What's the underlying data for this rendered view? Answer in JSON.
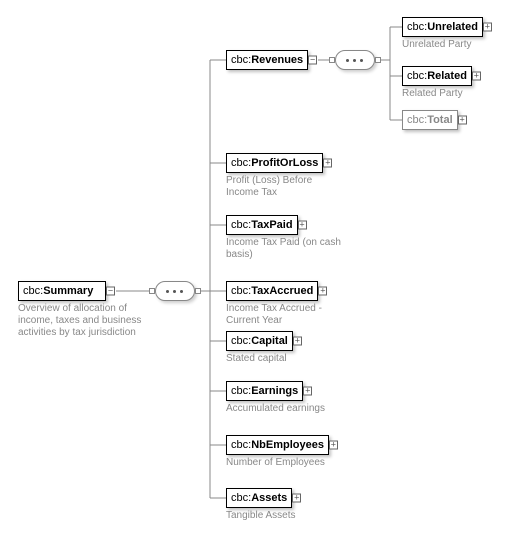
{
  "prefix": "cbc:",
  "root": {
    "name": "Summary",
    "desc": "Overview of allocation of income, taxes and business activities by tax jurisdiction"
  },
  "children": [
    {
      "name": "Revenues",
      "desc": ""
    },
    {
      "name": "ProfitOrLoss",
      "desc": "Profit (Loss) Before Income Tax"
    },
    {
      "name": "TaxPaid",
      "desc": "Income Tax Paid (on cash basis)"
    },
    {
      "name": "TaxAccrued",
      "desc": "Income Tax Accrued - Current Year"
    },
    {
      "name": "Capital",
      "desc": "Stated capital"
    },
    {
      "name": "Earnings",
      "desc": "Accumulated earnings"
    },
    {
      "name": "NbEmployees",
      "desc": "Number of Employees"
    },
    {
      "name": "Assets",
      "desc": "Tangible Assets"
    }
  ],
  "revenue_children": [
    {
      "name": "Unrelated",
      "desc": "Unrelated Party",
      "grey": false
    },
    {
      "name": "Related",
      "desc": "Related Party",
      "grey": false
    },
    {
      "name": "Total",
      "desc": "",
      "grey": true
    }
  ]
}
